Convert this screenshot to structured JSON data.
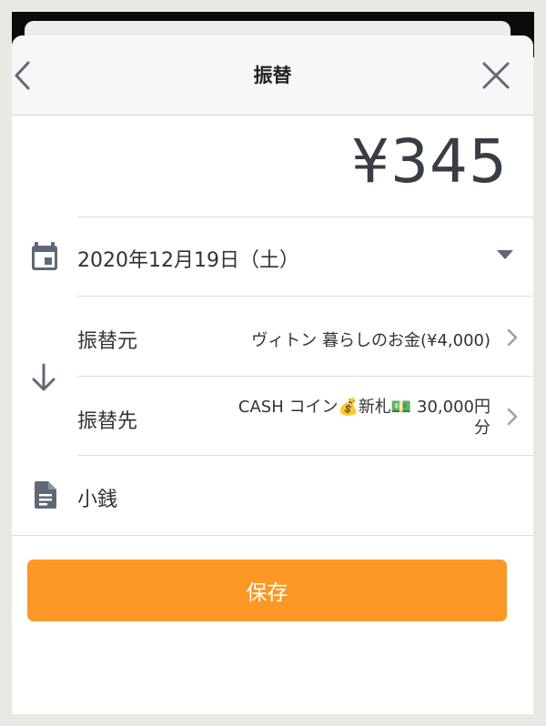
{
  "header": {
    "title": "振替"
  },
  "amount": "¥345",
  "date": {
    "value": "2020年12月19日（土）"
  },
  "transfer": {
    "from_label": "振替元",
    "from_value": "ヴィトン 暮らしのお金(¥4,000)",
    "to_label": "振替先",
    "to_value_line1": "CASH  コイン💰新札💵 30,000円",
    "to_value_line2": "分"
  },
  "memo": {
    "value": "小銭"
  },
  "save_button": {
    "label": "保存"
  },
  "icons": {
    "back": "chevron-left-icon",
    "close": "close-icon",
    "calendar": "calendar-icon",
    "dropdown": "caret-down-icon",
    "direction": "arrow-down-icon",
    "memo": "document-icon",
    "row_chevron": "chevron-right-icon"
  },
  "colors": {
    "accent": "#fd9725",
    "icon": "#5f6877",
    "text": "#333333"
  }
}
